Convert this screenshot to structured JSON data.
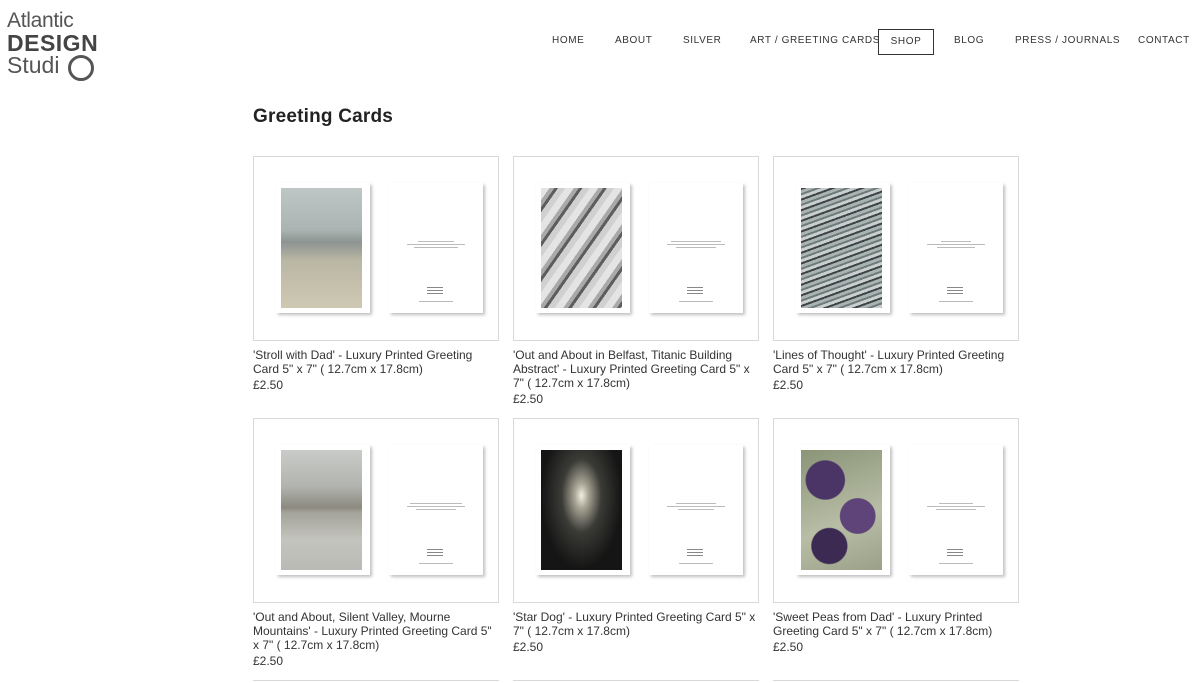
{
  "logo": {
    "line1": "Atlantic",
    "line2": "DESIGN",
    "line3": "Studi"
  },
  "nav": [
    {
      "label": "HOME"
    },
    {
      "label": "ABOUT"
    },
    {
      "label": "SILVER"
    },
    {
      "label": "ART / GREETING CARDS"
    },
    {
      "label": "SHOP"
    },
    {
      "label": "BLOG"
    },
    {
      "label": "PRESS / JOURNALS"
    },
    {
      "label": "CONTACT"
    }
  ],
  "page_title": "Greeting Cards",
  "products": [
    {
      "title": "'Stroll with Dad' - Luxury Printed Greeting Card 5\" x 7\" ( 12.7cm x 17.8cm)",
      "price": "£2.50"
    },
    {
      "title": "'Out and About in Belfast, Titanic Building Abstract' - Luxury Printed Greeting Card 5\" x 7\" ( 12.7cm x 17.8cm)",
      "price": "£2.50"
    },
    {
      "title": "'Lines of Thought' - Luxury Printed Greeting Card 5\" x 7\" ( 12.7cm x 17.8cm)",
      "price": "£2.50"
    },
    {
      "title": "'Out and About, Silent Valley, Mourne Mountains' - Luxury Printed Greeting Card 5\" x 7\" ( 12.7cm x 17.8cm)",
      "price": "£2.50"
    },
    {
      "title": "'Star Dog' - Luxury Printed Greeting Card 5\" x 7\" ( 12.7cm x 17.8cm)",
      "price": "£2.50"
    },
    {
      "title": "'Sweet Peas from Dad' - Luxury Printed Greeting Card 5\" x 7\" ( 12.7cm x 17.8cm)",
      "price": "£2.50"
    }
  ]
}
